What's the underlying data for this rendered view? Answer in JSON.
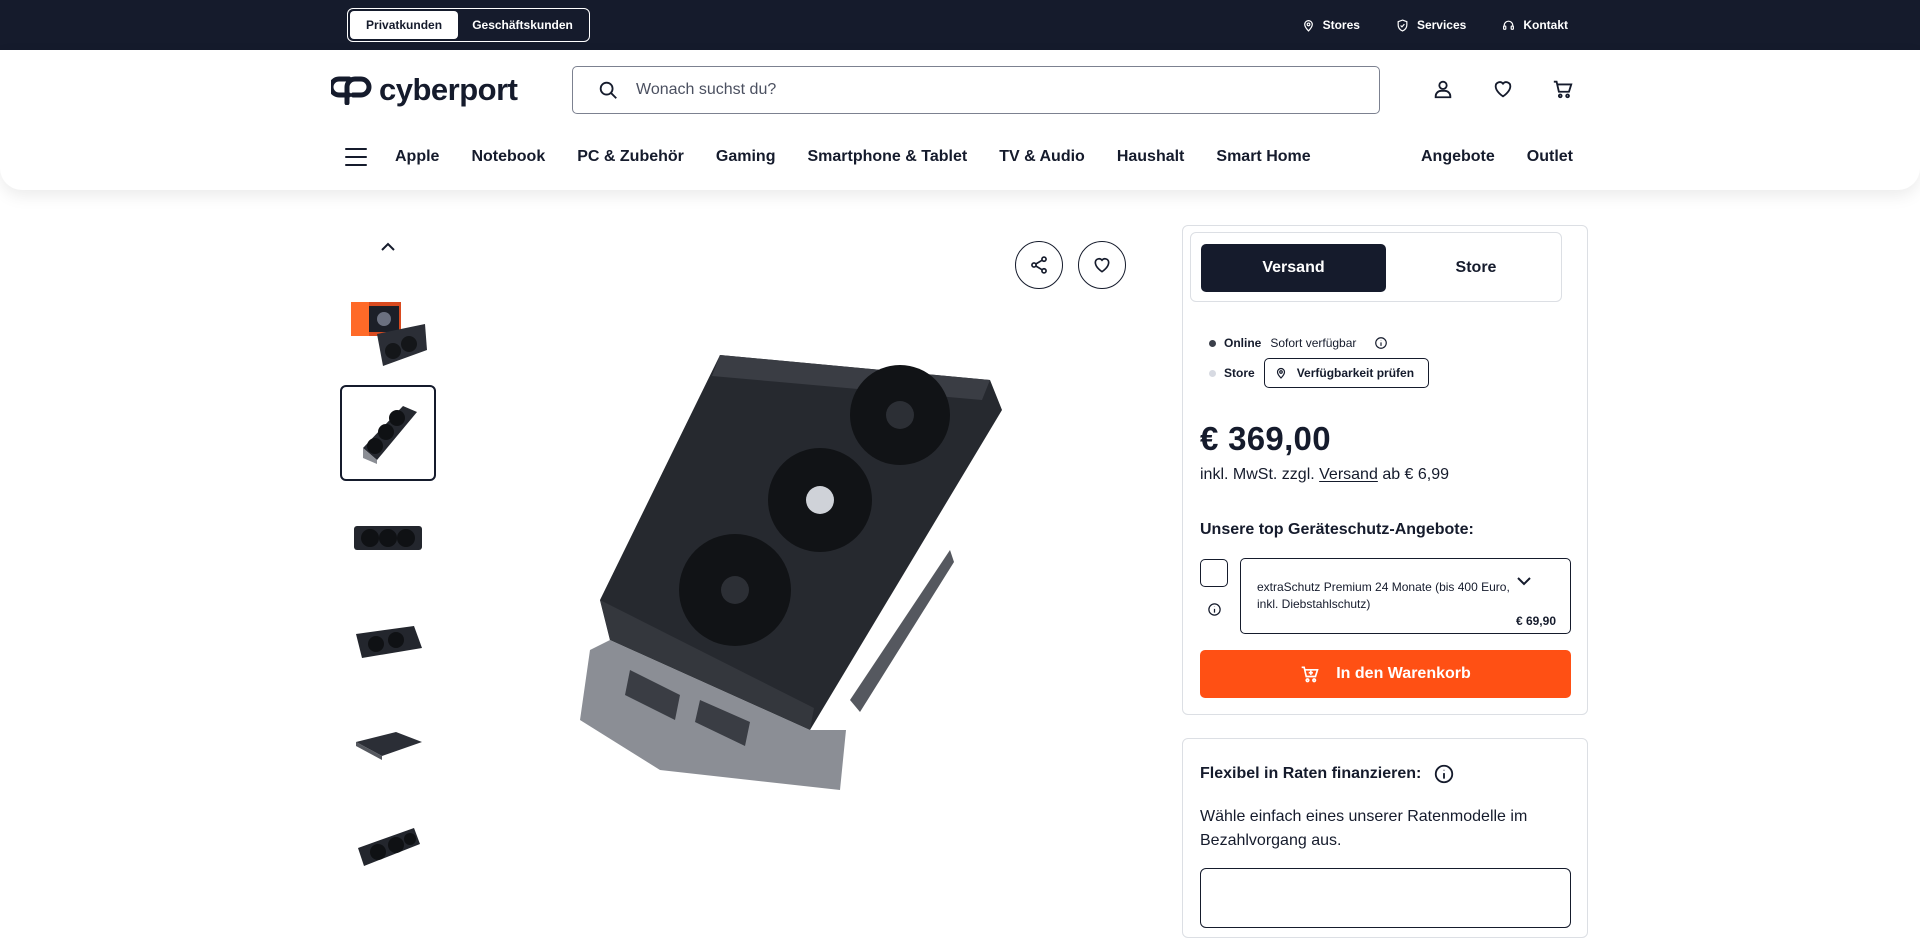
{
  "topbar": {
    "segment": {
      "active": "Privatkunden",
      "inactive": "Geschäftskunden"
    },
    "links": [
      {
        "label": "Stores",
        "icon": "location-pin-icon"
      },
      {
        "label": "Services",
        "icon": "shield-check-icon"
      },
      {
        "label": "Kontakt",
        "icon": "headset-icon"
      }
    ]
  },
  "header": {
    "logo_text": "cyberport",
    "search_placeholder": "Wonach suchst du?",
    "icons": [
      "account-icon",
      "heart-icon",
      "cart-icon"
    ]
  },
  "nav": {
    "left": [
      "Apple",
      "Notebook",
      "PC & Zubehör",
      "Gaming",
      "Smartphone & Tablet",
      "TV & Audio",
      "Haushalt",
      "Smart Home"
    ],
    "right": [
      "Angebote",
      "Outlet"
    ]
  },
  "gallery": {
    "thumb_count": 6,
    "selected_index": 1
  },
  "buybox": {
    "tabs": {
      "active": "Versand",
      "inactive": "Store"
    },
    "online": {
      "label": "Online",
      "status": "Sofort verfügbar",
      "dot_color": "#3b3f4a"
    },
    "store": {
      "label": "Store",
      "button": "Verfügbarkeit prüfen",
      "dot_color": "#d7dae2"
    },
    "price": "€ 369,00",
    "tax_prefix": "inkl. MwSt. zzgl.",
    "tax_link": "Versand",
    "tax_suffix": "ab € 6,99",
    "protection_title": "Unsere top Geräteschutz-Angebote:",
    "protection_option": "extraSchutz Premium 24 Monate (bis 400 Euro, inkl. Diebstahlschutz)",
    "protection_price": "€ 69,90",
    "cart_button": "In den Warenkorb",
    "accent_color": "#ff5014"
  },
  "financing": {
    "title": "Flexibel in Raten finanzieren:",
    "text": "Wähle einfach eines unserer Ratenmodelle im Bezahlvorgang aus."
  }
}
